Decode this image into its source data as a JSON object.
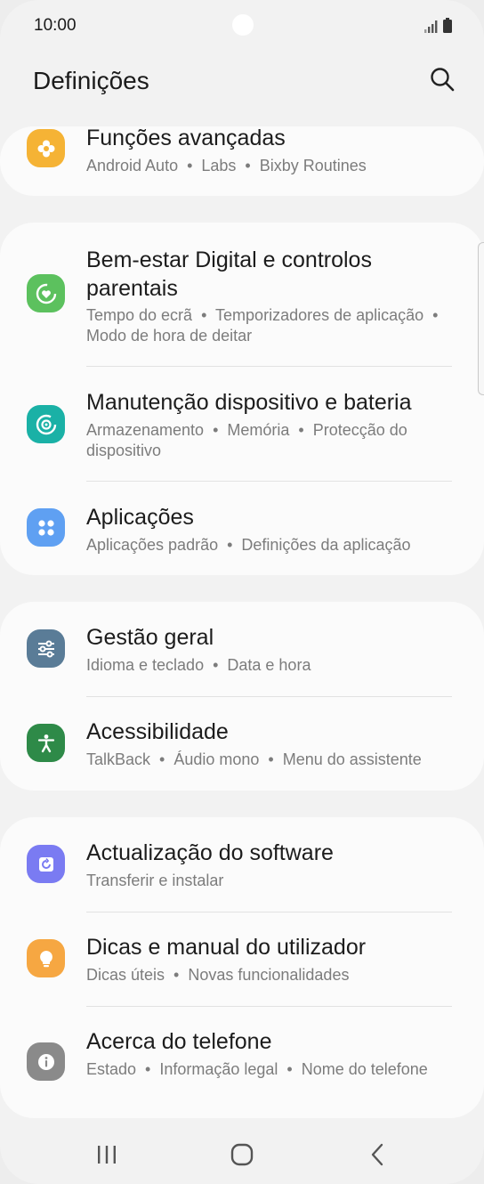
{
  "status_bar": {
    "time": "10:00"
  },
  "header": {
    "title": "Definições"
  },
  "colors": {
    "advanced": "#f5b335",
    "wellbeing": "#5cc15e",
    "device_care": "#1ab1a6",
    "apps": "#5fa0f2",
    "general": "#5a7c97",
    "accessibility": "#2e8a48",
    "software": "#7a7bf2",
    "tips": "#f6a742",
    "about": "#8a8a8a"
  },
  "items": [
    {
      "title": "Funções avançadas",
      "subtitle": "Android Auto  •  Labs  •  Bixby Routines",
      "icon": "puzzle-flower-icon"
    },
    {
      "title": "Bem-estar Digital e controlos parentais",
      "subtitle": "Tempo do ecrã  •  Temporizadores de aplicação  •  Modo de hora de deitar",
      "icon": "wellbeing-heart-icon"
    },
    {
      "title": "Manutenção dispositivo e bateria",
      "subtitle": "Armazenamento  •  Memória  •  Protecção do dispositivo",
      "icon": "device-care-icon"
    },
    {
      "title": "Aplicações",
      "subtitle": "Aplicações padrão  •  Definições da aplicação",
      "icon": "apps-grid-icon"
    },
    {
      "title": "Gestão geral",
      "subtitle": "Idioma e teclado  •  Data e hora",
      "icon": "sliders-icon"
    },
    {
      "title": "Acessibilidade",
      "subtitle": "TalkBack  •  Áudio mono  •  Menu do assistente",
      "icon": "accessibility-person-icon"
    },
    {
      "title": "Actualização do software",
      "subtitle": "Transferir e instalar",
      "icon": "software-update-icon"
    },
    {
      "title": "Dicas e manual do utilizador",
      "subtitle": "Dicas úteis  •  Novas funcionalidades",
      "icon": "lightbulb-icon"
    },
    {
      "title": "Acerca do telefone",
      "subtitle": "Estado  •  Informação legal  •  Nome do telefone",
      "icon": "info-icon"
    }
  ],
  "navbar": {
    "recent": "recents-icon",
    "home": "home-icon",
    "back": "back-icon"
  }
}
